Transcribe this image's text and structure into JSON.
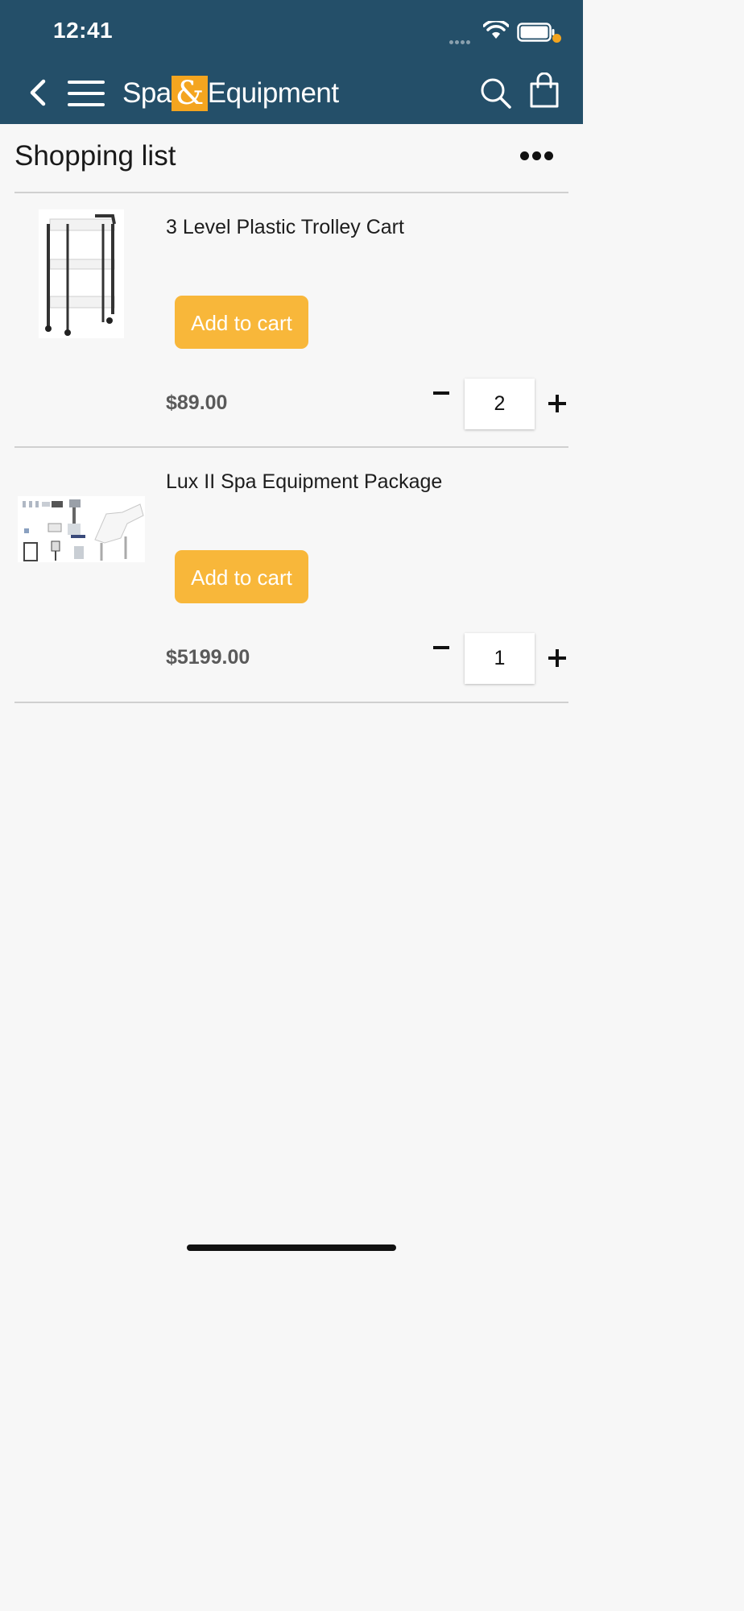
{
  "status_bar": {
    "time": "12:41"
  },
  "header": {
    "logo_left": "Spa",
    "logo_amp": "&",
    "logo_right": "Equipment"
  },
  "page": {
    "title": "Shopping list"
  },
  "items": [
    {
      "name": "3 Level Plastic Trolley Cart",
      "add_label": "Add to cart",
      "price": "$89.00",
      "quantity": "2"
    },
    {
      "name": "Lux II Spa Equipment Package",
      "add_label": "Add to cart",
      "price": "$5199.00",
      "quantity": "1"
    }
  ],
  "icons": {
    "back": "chevron-left-icon",
    "menu": "hamburger-icon",
    "search": "search-icon",
    "cart": "shopping-bag-icon",
    "more": "more-dots-icon"
  },
  "colors": {
    "header_bg": "#244f69",
    "accent": "#f4a51f",
    "button": "#f8b73a"
  }
}
